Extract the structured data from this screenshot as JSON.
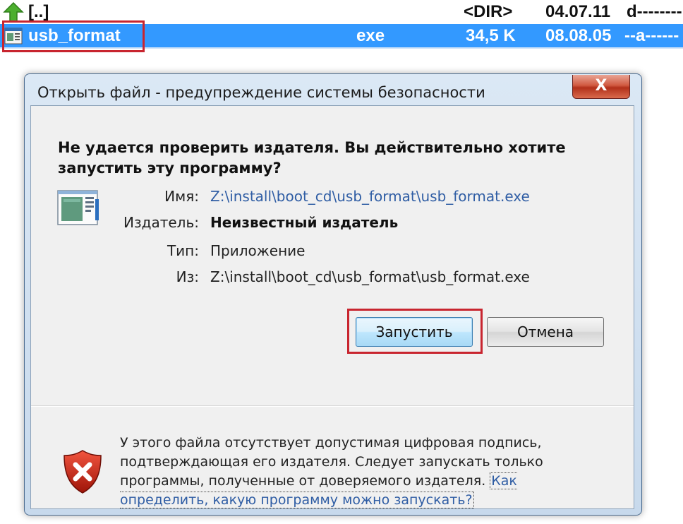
{
  "file_manager": {
    "parent_row": {
      "name": "[..]",
      "size": "<DIR>",
      "date": "04.07.11",
      "attr": "d--------"
    },
    "selected_row": {
      "name": "usb_format",
      "ext": "exe",
      "size": "34,5 K",
      "date": "08.08.05",
      "attr": "--a------"
    },
    "colors": {
      "selection": "#3399ff",
      "highlight_frame": "#c8252f"
    }
  },
  "dialog": {
    "title": "Открыть файл - предупреждение системы безопасности",
    "close_label": "X",
    "warning_heading": "Не удается проверить издателя.  Вы действительно хотите запустить эту программу?",
    "icon": "application-icon",
    "properties": [
      {
        "label": "Имя:",
        "value": "Z:\\install\\boot_cd\\usb_format\\usb_format.exe"
      },
      {
        "label": "Издатель:",
        "value": "Неизвестный издатель"
      },
      {
        "label": "Тип:",
        "value": "Приложение"
      },
      {
        "label": "Из:",
        "value": "Z:\\install\\boot_cd\\usb_format\\usb_format.exe"
      }
    ],
    "buttons": {
      "run": "Запустить",
      "cancel": "Отмена"
    },
    "footer": {
      "icon": "security-shield-error-icon",
      "text": "У этого файла отсутствует допустимая цифровая подпись, подтверждающая его издателя. Следует запускать только программы, полученные от доверяемого издателя.",
      "link": "Как определить, какую программу можно запускать?"
    }
  }
}
